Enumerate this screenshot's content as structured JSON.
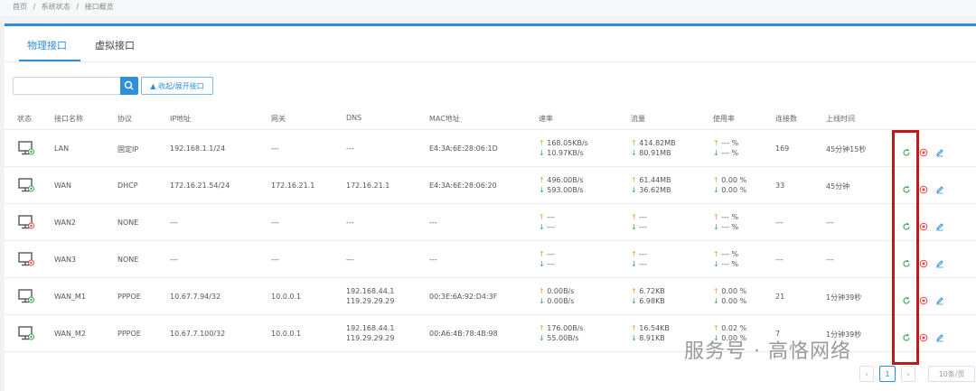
{
  "breadcrumb": [
    "首页",
    "/",
    "系统状态",
    "/",
    "接口概览"
  ],
  "tabs": {
    "physical": "物理接口",
    "virtual": "虚拟接口"
  },
  "search": {
    "value": "",
    "collapse_label": "▲ 收起/展开接口"
  },
  "columns": [
    "状态",
    "接口名称",
    "协议",
    "IP地址",
    "网关",
    "DNS",
    "MAC地址",
    "速率",
    "流量",
    "使用率",
    "连接数",
    "上线时间"
  ],
  "rows": [
    {
      "name": "LAN",
      "proto": "固定IP",
      "ip": "192.168.1.1/24",
      "gw": "---",
      "dns1": "---",
      "dns2": "",
      "mac": "E4:3A:6E:28:06:1D",
      "rate_up": "168.05KB/s",
      "rate_down": "10.97KB/s",
      "flow_up": "414.82MB",
      "flow_down": "80.91MB",
      "use_up": "--- %",
      "use_down": "--- %",
      "conn": "169",
      "uptime": "45分钟15秒",
      "status": "up"
    },
    {
      "name": "WAN",
      "proto": "DHCP",
      "ip": "172.16.21.54/24",
      "gw": "172.16.21.1",
      "dns1": "172.16.21.1",
      "dns2": "",
      "mac": "E4:3A:6E:28:06:20",
      "rate_up": "496.00B/s",
      "rate_down": "593.00B/s",
      "flow_up": "61.44MB",
      "flow_down": "36.62MB",
      "use_up": "0.00 %",
      "use_down": "0.00 %",
      "conn": "33",
      "uptime": "45分钟",
      "status": "up"
    },
    {
      "name": "WAN2",
      "proto": "NONE",
      "ip": "---",
      "gw": "---",
      "dns1": "---",
      "dns2": "",
      "mac": "---",
      "rate_up": "---",
      "rate_down": "---",
      "flow_up": "---",
      "flow_down": "---",
      "use_up": "--- %",
      "use_down": "--- %",
      "conn": "---",
      "uptime": "---",
      "status": "down"
    },
    {
      "name": "WAN3",
      "proto": "NONE",
      "ip": "---",
      "gw": "---",
      "dns1": "---",
      "dns2": "",
      "mac": "---",
      "rate_up": "---",
      "rate_down": "---",
      "flow_up": "---",
      "flow_down": "---",
      "use_up": "--- %",
      "use_down": "--- %",
      "conn": "---",
      "uptime": "---",
      "status": "down"
    },
    {
      "name": "WAN_M1",
      "proto": "PPPOE",
      "ip": "10.67.7.94/32",
      "gw": "10.0.0.1",
      "dns1": "192.168.44.1",
      "dns2": "119.29.29.29",
      "mac": "00:3E:6A:92:D4:3F",
      "rate_up": "0.00B/s",
      "rate_down": "0.00B/s",
      "flow_up": "6.72KB",
      "flow_down": "6.98KB",
      "use_up": "0.00 %",
      "use_down": "0.00 %",
      "conn": "21",
      "uptime": "1分钟39秒",
      "status": "up"
    },
    {
      "name": "WAN_M2",
      "proto": "PPPOE",
      "ip": "10.67.7.100/32",
      "gw": "10.0.0.1",
      "dns1": "192.168.44.1",
      "dns2": "119.29.29.29",
      "mac": "00:A6:4B:78:4B:98",
      "rate_up": "176.00B/s",
      "rate_down": "55.00B/s",
      "flow_up": "16.54KB",
      "flow_down": "8.91KB",
      "use_up": "0.02 %",
      "use_down": "0.00 %",
      "conn": "7",
      "uptime": "1分钟39秒",
      "status": "up"
    }
  ],
  "pagination": {
    "prev": "‹",
    "page": "1",
    "next": "›",
    "size": "10条/页"
  },
  "watermark": "服务号 · 高恪网络",
  "colors": {
    "accent": "#2f8fd8",
    "up": "#e6a23c",
    "down": "#3aa757",
    "highlight": "#c0191c"
  },
  "icons": {
    "refresh": "refresh-icon",
    "stop": "stop-icon",
    "edit": "edit-icon",
    "monitor": "monitor-icon",
    "search": "search-icon"
  }
}
